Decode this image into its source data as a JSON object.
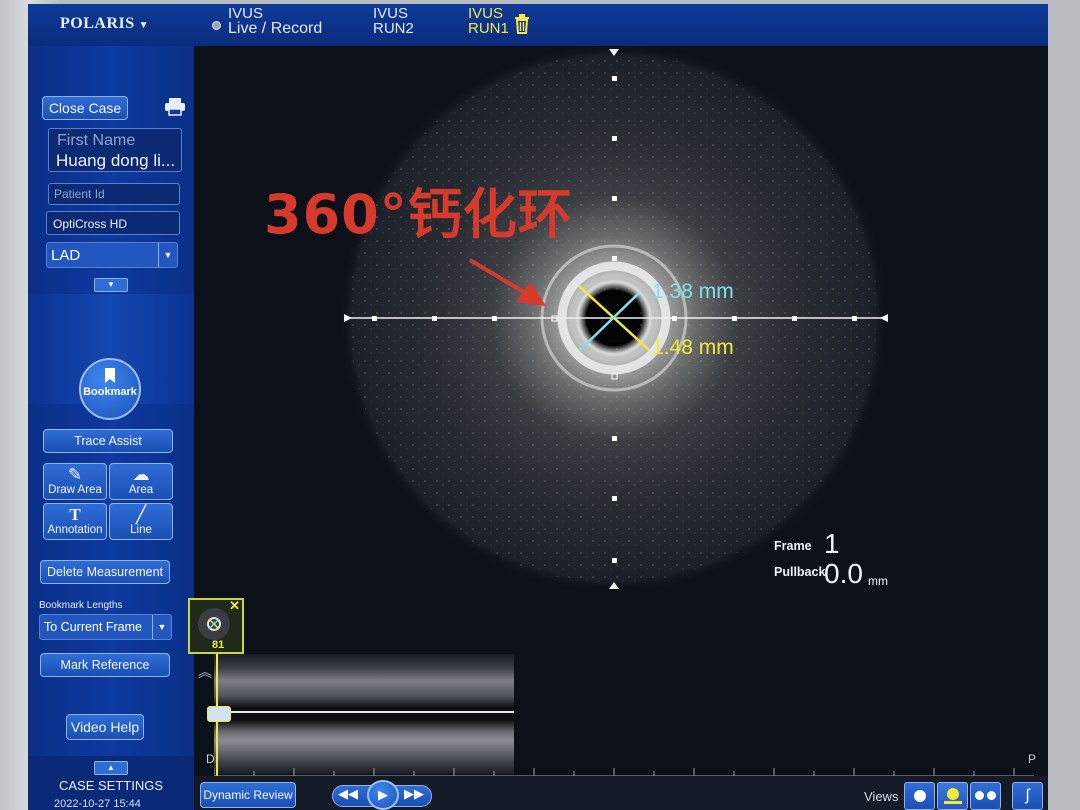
{
  "header": {
    "brand": "POLARIS",
    "tabs": [
      {
        "line1": "IVUS",
        "line2": "Live / Record",
        "active": false
      },
      {
        "line1": "IVUS",
        "line2": "RUN2",
        "active": false
      },
      {
        "line1": "IVUS",
        "line2": "RUN1",
        "active": true
      }
    ]
  },
  "sidebar": {
    "close_case": "Close Case",
    "first_name_placeholder": "First Name",
    "first_name_value": "Huang dong li...",
    "patient_id_placeholder": "Patient Id",
    "catheter": "OptiCross HD",
    "vessel": "LAD",
    "bookmark": "Bookmark",
    "trace_assist": "Trace Assist",
    "tools": [
      {
        "label": "Draw Area",
        "icon": "draw-area-icon"
      },
      {
        "label": "Area",
        "icon": "area-icon"
      },
      {
        "label": "Annotation",
        "icon": "annotation-icon"
      },
      {
        "label": "Line",
        "icon": "line-icon"
      }
    ],
    "delete_measurement": "Delete Measurement",
    "bookmark_lengths_label": "Bookmark Lengths",
    "bookmark_lengths_value": "To Current Frame",
    "mark_reference": "Mark Reference",
    "video_help": "Video Help",
    "case_settings": "CASE SETTINGS",
    "datetime": "2022-10-27 15:44"
  },
  "image": {
    "annotation": "360°钙化环",
    "measure_cyan": "1.38 mm",
    "measure_yellow": "1.48 mm",
    "frame_label": "Frame",
    "frame_value": "1",
    "pullback_label": "Pullback",
    "pullback_value": "0.0",
    "pullback_unit": "mm",
    "thumb_frame": "81",
    "longview_d": "D",
    "longview_p": "P"
  },
  "footer": {
    "dynamic_review": "Dynamic Review",
    "views_label": "Views"
  },
  "colors": {
    "accent_blue": "#0d3aa0",
    "active_yellow": "#f3e64a",
    "annotation_red": "#d63a2c",
    "measure_cyan": "#7fe3ea",
    "measure_yellow": "#f1ea3a"
  }
}
